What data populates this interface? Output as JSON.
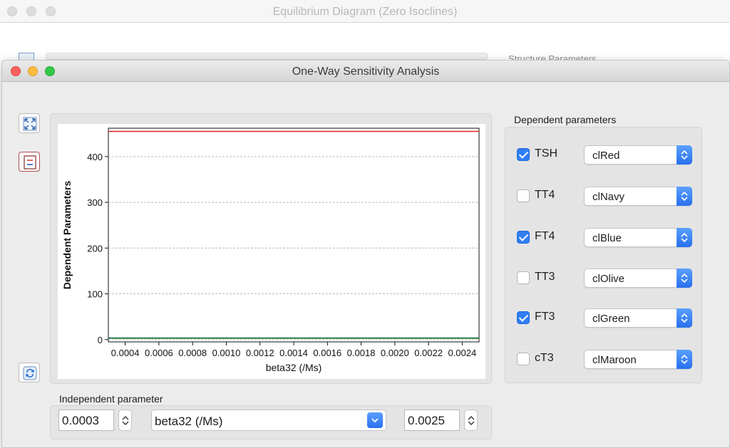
{
  "background_window": {
    "title": "Equilibrium Diagram (Zero Isoclines)",
    "partial_label": "Structure Parameters"
  },
  "window": {
    "title": "One-Way Sensitivity Analysis",
    "toolbar": {
      "zoom_icon": "fullscreen-icon",
      "legend_icon": "legend-icon",
      "refresh_icon": "refresh-icon"
    }
  },
  "chart_data": {
    "type": "line",
    "xlabel": "beta32 (/Ms)",
    "ylabel": "Dependent Parameters",
    "xlim": [
      0.0003,
      0.0025
    ],
    "ylim": [
      -5,
      462
    ],
    "grid": true,
    "x_ticks": [
      0.0004,
      0.0006,
      0.0008,
      0.001,
      0.0012,
      0.0014,
      0.0016,
      0.0018,
      0.002,
      0.0022,
      0.0024
    ],
    "x_tick_labels": [
      "0.0004",
      "0.0006",
      "0.0008",
      "0.0010",
      "0.0012",
      "0.0014",
      "0.0016",
      "0.0018",
      "0.0020",
      "0.0022",
      "0.0024"
    ],
    "y_ticks": [
      0,
      100,
      200,
      300,
      400
    ],
    "y_tick_labels": [
      "0",
      "100",
      "200",
      "300",
      "400"
    ],
    "x": [
      0.0003,
      0.0025
    ],
    "series": [
      {
        "color": "#e62020",
        "values": [
          455,
          455
        ]
      },
      {
        "color": "#1f4fd6",
        "values": [
          3.5,
          3.5
        ]
      },
      {
        "color": "#1a7a1a",
        "values": [
          3,
          3
        ]
      }
    ]
  },
  "dependent": {
    "label": "Dependent parameters",
    "items": [
      {
        "name": "TSH",
        "checked": true,
        "color": "clRed"
      },
      {
        "name": "TT4",
        "checked": false,
        "color": "clNavy"
      },
      {
        "name": "FT4",
        "checked": true,
        "color": "clBlue"
      },
      {
        "name": "TT3",
        "checked": false,
        "color": "clOlive"
      },
      {
        "name": "FT3",
        "checked": true,
        "color": "clGreen"
      },
      {
        "name": "cT3",
        "checked": false,
        "color": "clMaroon"
      }
    ]
  },
  "independent": {
    "label": "Independent parameter",
    "min_value": "0.0003",
    "parameter": "beta32 (/Ms)",
    "max_value": "0.0025"
  }
}
